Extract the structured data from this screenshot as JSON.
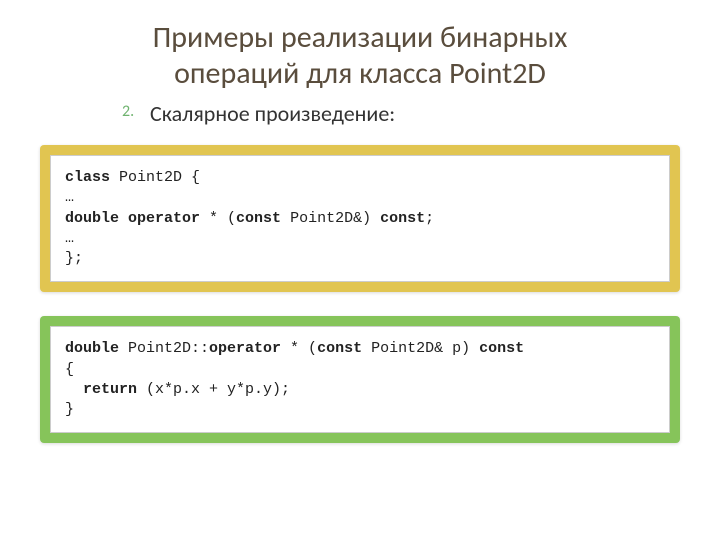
{
  "title_line1": "Примеры реализации бинарных",
  "title_line2": "операций для класса Point2D",
  "list_number": "2.",
  "subtitle": "Скалярное произведение:",
  "code1": {
    "l1a": "class",
    "l1b": " Point2D {",
    "l2": "…",
    "l3a": "double operator",
    "l3b": " * (",
    "l3c": "const",
    "l3d": " Point2D&) ",
    "l3e": "const",
    "l3f": ";",
    "l4": "…",
    "l5": "};"
  },
  "code2": {
    "l1a": "double",
    "l1b": " Point2D::",
    "l1c": "operator",
    "l1d": " * (",
    "l1e": "const",
    "l1f": " Point2D& p) ",
    "l1g": "const",
    "l2": "{",
    "l3a": "  ",
    "l3b": "return",
    "l3c": " (x*p.x + y*p.y);",
    "l4": "}"
  }
}
